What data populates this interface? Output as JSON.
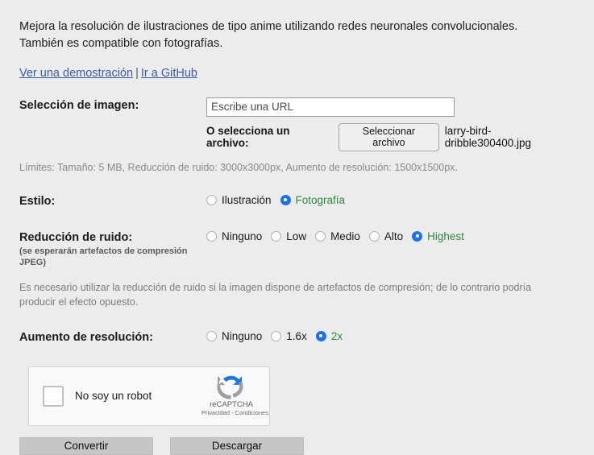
{
  "intro": {
    "description": "Mejora la resolución de ilustraciones de tipo anime utilizando redes neuronales convolucionales. También es compatible con fotografías.",
    "link_demo": "Ver una demostración",
    "link_separator": "|",
    "link_github": "Ir a GitHub"
  },
  "image_selection": {
    "label": "Selección de imagen:",
    "url_placeholder": "Escribe una URL",
    "url_value": "",
    "file_prompt": "O selecciona un archivo:",
    "file_button": "Seleccionar archivo",
    "file_name": "larry-bird-dribble300400.jpg",
    "limits": "Límites: Tamaño: 5 MB, Reducción de ruido: 3000x3000px, Aumento de resolución: 1500x1500px."
  },
  "style": {
    "label": "Estilo:",
    "options": [
      {
        "label": "Ilustración",
        "selected": false
      },
      {
        "label": "Fotografía",
        "selected": true
      }
    ]
  },
  "noise": {
    "label": "Reducción de ruido:",
    "sublabel": "(se esperarán artefactos de compresión JPEG)",
    "options": [
      {
        "label": "Ninguno",
        "selected": false
      },
      {
        "label": "Low",
        "selected": false
      },
      {
        "label": "Medio",
        "selected": false
      },
      {
        "label": "Alto",
        "selected": false
      },
      {
        "label": "Highest",
        "selected": true
      }
    ],
    "note": "Es necesario utilizar la reducción de ruido si la imagen dispone de artefactos de compresión; de lo contrario podría producir el efecto opuesto."
  },
  "scale": {
    "label": "Aumento de resolución:",
    "options": [
      {
        "label": "Ninguno",
        "selected": false
      },
      {
        "label": "1.6x",
        "selected": false
      },
      {
        "label": "2x",
        "selected": true
      }
    ]
  },
  "recaptcha": {
    "checkbox_label": "No soy un robot",
    "brand": "reCAPTCHA",
    "legal": "Privacidad - Condiciones",
    "checked": false
  },
  "actions": {
    "convert": "Convertir",
    "download": "Descargar"
  },
  "colors": {
    "background": "#ececec",
    "link": "#3b5ca8",
    "selected_label": "#2e8b3d",
    "radio_checked": "#1a73e8",
    "button_face": "#c6c6c6"
  }
}
